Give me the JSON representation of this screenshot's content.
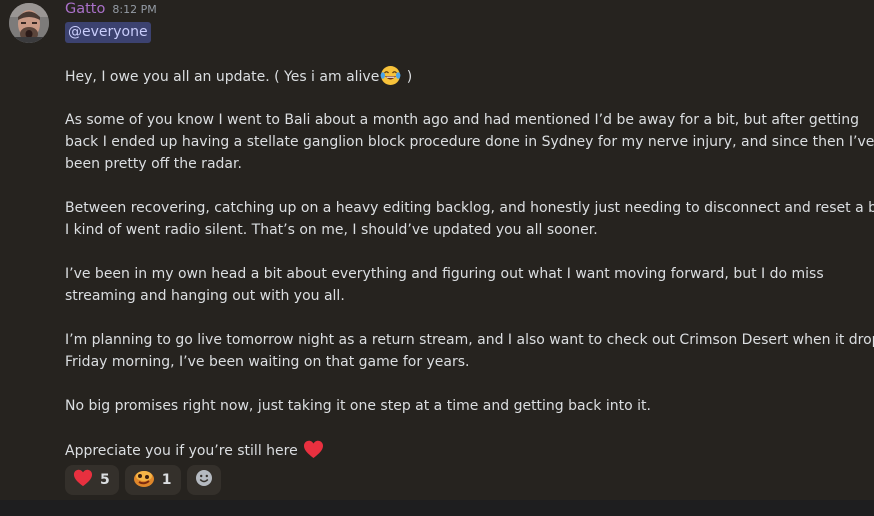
{
  "message": {
    "author": "Gatto",
    "timestamp": "8:12 PM",
    "mention": "@everyone",
    "paragraphs": {
      "p1a": "Hey, I owe you all an update. ( Yes i am alive",
      "p1b": " )",
      "p2_line1": "As some of you know I went to Bali about a month ago and had mentioned I’d be away for a bit, but after getting",
      "p2_line2": "back I ended up having a stellate ganglion block procedure done in Sydney for my nerve injury, and since then I’ve",
      "p2_line3": "been pretty off the radar.",
      "p3_line1": "Between recovering, catching up on a heavy editing backlog, and honestly just needing to disconnect and reset a bit,",
      "p3_line2": "I kind of went radio silent. That’s on me, I should’ve updated you all sooner.",
      "p4_line1": "I’ve been in my own head a bit about everything and figuring out what I want moving forward, but I do miss",
      "p4_line2": "streaming and hanging out with you all.",
      "p5_line1": "I’m planning to go live tomorrow night as a return stream, and I also want to check out Crimson Desert when it drops",
      "p5_line2": "Friday morning, I’ve been waiting on that game for years.",
      "p6": "No big promises right now, just taking it one step at a time and getting back into it.",
      "p7": "Appreciate you if you’re still here"
    },
    "inline_emojis": [
      "joy-emoji",
      "red-heart-emoji"
    ],
    "reactions": [
      {
        "emoji": "red-heart-emoji",
        "count": "5"
      },
      {
        "emoji": "custom-reaction-emoji",
        "count": "1"
      }
    ],
    "add_reaction_icon": "add-reaction-icon"
  },
  "colors": {
    "background": "#26231f",
    "username": "#a970c8",
    "mention_bg": "#3c4270",
    "mention_text": "#c9cdfb",
    "text": "#dbdee1",
    "reaction_bg": "#34302b",
    "heart": "#e8303f"
  }
}
